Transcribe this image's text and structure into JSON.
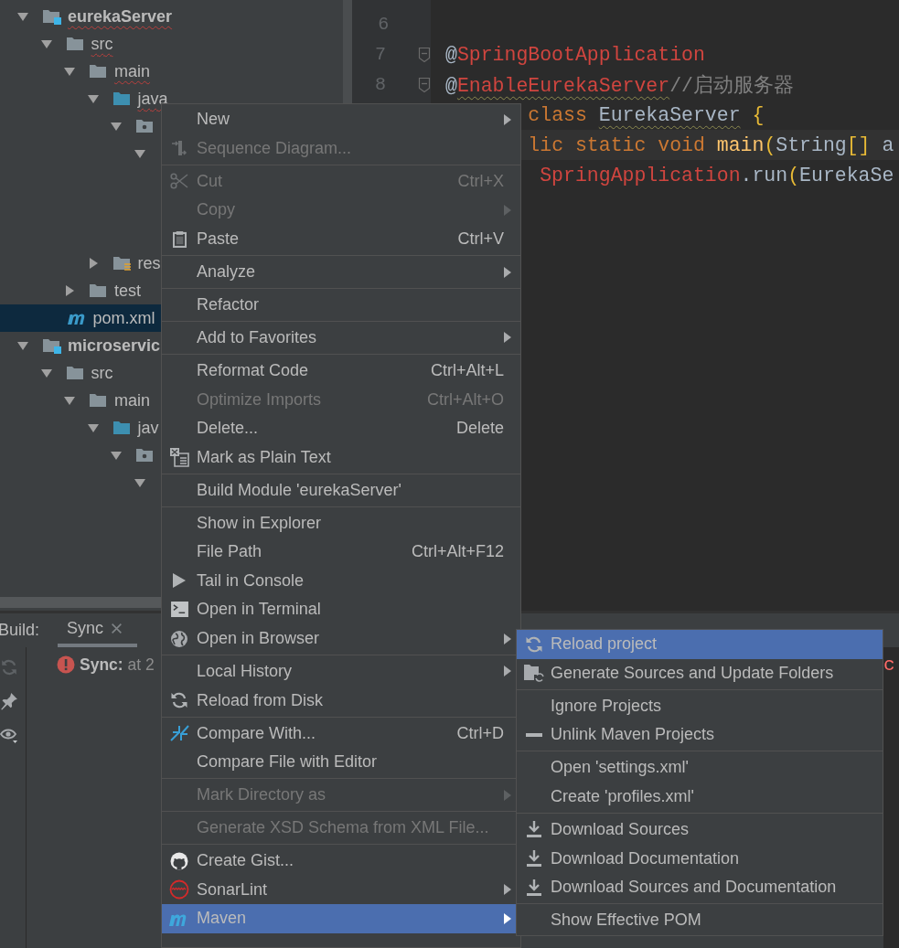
{
  "project_tree": [
    {
      "label": "eurekaServer",
      "kind": "module",
      "expanded": true,
      "error": true,
      "selected": false,
      "children": [
        {
          "label": "src",
          "kind": "folder",
          "expanded": true,
          "error": true,
          "selected": false,
          "children": [
            {
              "label": "main",
              "kind": "folder",
              "expanded": true,
              "error": true,
              "selected": false,
              "children": [
                {
                  "label": "java",
                  "kind": "source-folder",
                  "expanded": true,
                  "error": true,
                  "selected": false,
                  "children": [
                    {
                      "kind": "package",
                      "expanded": true,
                      "selected": false,
                      "children": [
                        {
                          "expanded": true
                        }
                      ]
                    }
                  ]
                },
                {
                  "label": "res",
                  "kind": "resources",
                  "expanded": false,
                  "error": false,
                  "selected": false
                }
              ]
            },
            {
              "label": "test",
              "kind": "folder",
              "expanded": false,
              "error": false,
              "selected": false
            }
          ]
        },
        {
          "label": "pom.xml",
          "kind": "maven-file",
          "error": false,
          "selected": true
        }
      ]
    },
    {
      "label": "microservic",
      "kind": "module",
      "expanded": true,
      "error": false,
      "selected": false,
      "children": [
        {
          "label": "src",
          "kind": "folder",
          "expanded": true,
          "error": false,
          "selected": false,
          "children": [
            {
              "label": "main",
              "kind": "folder",
              "expanded": true,
              "error": false,
              "selected": false,
              "children": [
                {
                  "label": "jav",
                  "kind": "source-folder",
                  "expanded": true,
                  "error": false,
                  "selected": false,
                  "children": [
                    {
                      "kind": "package",
                      "expanded": true,
                      "selected": false,
                      "children": [
                        {
                          "expanded": true
                        }
                      ]
                    }
                  ]
                }
              ]
            }
          ]
        }
      ]
    }
  ],
  "editor": {
    "lines": [
      {
        "number": "6"
      },
      {
        "number": "7",
        "fold": true,
        "tokens": [
          {
            "text": "@",
            "kind": "plain"
          },
          {
            "text": "SpringBootApplication",
            "kind": "annotation"
          }
        ]
      },
      {
        "number": "8",
        "fold": true,
        "tokens": [
          {
            "text": "@",
            "kind": "plain"
          },
          {
            "text": "EnableEurekaServer",
            "kind": "annotation",
            "warning": true
          },
          {
            "text": "//启动服务器",
            "kind": "comment"
          }
        ]
      },
      {
        "tokens": [
          {
            "text": "       class ",
            "kind": "keyword"
          },
          {
            "text": "EurekaServer",
            "kind": "plain",
            "warning": true
          },
          {
            "text": " {",
            "kind": "bracket"
          }
        ]
      },
      {
        "current": true,
        "tokens": [
          {
            "text": "       lic static void ",
            "kind": "keyword"
          },
          {
            "text": "main",
            "kind": "method"
          },
          {
            "text": "(",
            "kind": "bracket"
          },
          {
            "text": "String",
            "kind": "plain"
          },
          {
            "text": "[]",
            "kind": "bracket"
          },
          {
            "text": " a",
            "kind": "plain"
          }
        ]
      },
      {
        "tokens": [
          {
            "text": "        SpringApplication",
            "kind": "annotation"
          },
          {
            "text": ".run",
            "kind": "plain"
          },
          {
            "text": "(",
            "kind": "bracket"
          },
          {
            "text": "EurekaSe",
            "kind": "plain"
          }
        ]
      }
    ]
  },
  "build_panel": {
    "label": "Build:",
    "tabs": [
      {
        "label": "Sync",
        "selected": true,
        "closable": true
      }
    ],
    "rows": [
      {
        "error": true,
        "title": "Sync:",
        "detail": "at 2"
      }
    ],
    "console": {
      "text": "c"
    }
  },
  "context_menu": {
    "groups": [
      [
        {
          "label": "New",
          "submenu": true,
          "disabled": false,
          "selected": false
        },
        {
          "label": "Sequence Diagram...",
          "submenu": false,
          "disabled": true,
          "selected": false
        }
      ],
      [
        {
          "label": "Cut",
          "shortcut": "Ctrl+X",
          "submenu": false,
          "disabled": true,
          "selected": false
        },
        {
          "label": "Copy",
          "submenu": true,
          "disabled": true,
          "selected": false
        },
        {
          "label": "Paste",
          "shortcut": "Ctrl+V",
          "submenu": false,
          "disabled": false,
          "selected": false
        }
      ],
      [
        {
          "label": "Analyze",
          "submenu": true,
          "disabled": false,
          "selected": false
        }
      ],
      [
        {
          "label": "Refactor",
          "submenu": false,
          "disabled": false,
          "selected": false
        }
      ],
      [
        {
          "label": "Add to Favorites",
          "submenu": true,
          "disabled": false,
          "selected": false
        }
      ],
      [
        {
          "label": "Reformat Code",
          "shortcut": "Ctrl+Alt+L",
          "submenu": false,
          "disabled": false,
          "selected": false
        },
        {
          "label": "Optimize Imports",
          "shortcut": "Ctrl+Alt+O",
          "submenu": false,
          "disabled": true,
          "selected": false
        },
        {
          "label": "Delete...",
          "shortcut": "Delete",
          "submenu": false,
          "disabled": false,
          "selected": false
        },
        {
          "label": "Mark as Plain Text",
          "submenu": false,
          "disabled": false,
          "selected": false
        }
      ],
      [
        {
          "label": "Build Module 'eurekaServer'",
          "submenu": false,
          "disabled": false,
          "selected": false
        }
      ],
      [
        {
          "label": "Show in Explorer",
          "submenu": false,
          "disabled": false,
          "selected": false
        },
        {
          "label": "File Path",
          "shortcut": "Ctrl+Alt+F12",
          "submenu": false,
          "disabled": false,
          "selected": false
        },
        {
          "label": "Tail in Console",
          "submenu": false,
          "disabled": false,
          "selected": false
        },
        {
          "label": "Open in Terminal",
          "submenu": false,
          "disabled": false,
          "selected": false
        },
        {
          "label": "Open in Browser",
          "submenu": true,
          "disabled": false,
          "selected": false
        }
      ],
      [
        {
          "label": "Local History",
          "submenu": true,
          "disabled": false,
          "selected": false
        },
        {
          "label": "Reload from Disk",
          "submenu": false,
          "disabled": false,
          "selected": false
        }
      ],
      [
        {
          "label": "Compare With...",
          "shortcut": "Ctrl+D",
          "submenu": false,
          "disabled": false,
          "selected": false
        },
        {
          "label": "Compare File with Editor",
          "submenu": false,
          "disabled": false,
          "selected": false
        }
      ],
      [
        {
          "label": "Mark Directory as",
          "submenu": true,
          "disabled": true,
          "selected": false
        }
      ],
      [
        {
          "label": "Generate XSD Schema from XML File...",
          "submenu": false,
          "disabled": true,
          "selected": false
        }
      ],
      [
        {
          "label": "Create Gist...",
          "submenu": false,
          "disabled": false,
          "selected": false
        },
        {
          "label": "SonarLint",
          "submenu": true,
          "disabled": false,
          "selected": false
        },
        {
          "label": "Maven",
          "submenu": true,
          "disabled": false,
          "selected": true
        }
      ]
    ]
  },
  "maven_submenu": {
    "groups": [
      [
        {
          "label": "Reload project",
          "selected": true
        },
        {
          "label": "Generate Sources and Update Folders",
          "selected": false
        }
      ],
      [
        {
          "label": "Ignore Projects",
          "selected": false
        },
        {
          "label": "Unlink Maven Projects",
          "selected": false
        }
      ],
      [
        {
          "label": "Open 'settings.xml'",
          "selected": false
        },
        {
          "label": "Create 'profiles.xml'",
          "selected": false
        }
      ],
      [
        {
          "label": "Download Sources",
          "selected": false
        },
        {
          "label": "Download Documentation",
          "selected": false
        },
        {
          "label": "Download Sources and Documentation",
          "selected": false
        }
      ],
      [
        {
          "label": "Show Effective POM",
          "selected": false
        }
      ]
    ]
  }
}
